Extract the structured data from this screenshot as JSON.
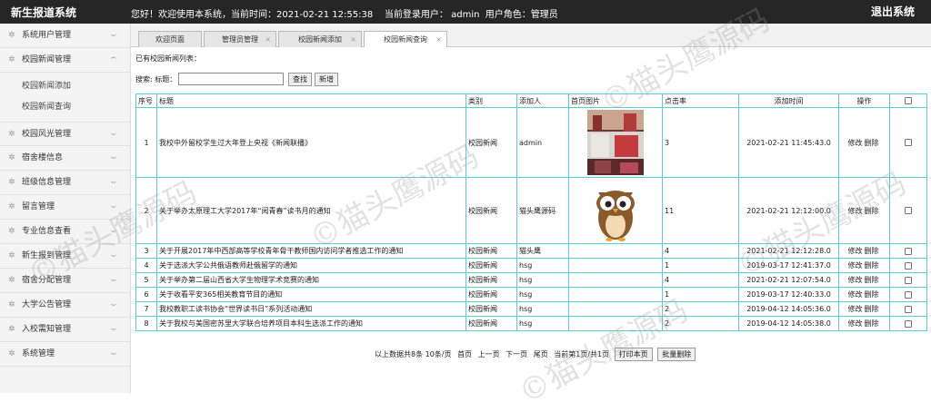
{
  "header": {
    "title": "新生报道系统",
    "welcome": "您好！欢迎使用本系统，当前时间：2021-02-21 12:55:38    当前登录用户： admin  用户角色：管理员",
    "logout": "退出系统"
  },
  "sidebar": {
    "menu_top": [
      {
        "label": "系统用户管理"
      },
      {
        "label": "校园新闻管理"
      }
    ],
    "sub_items": [
      {
        "label": "校园新闻添加"
      },
      {
        "label": "校园新闻查询"
      }
    ],
    "menu_bottom": [
      {
        "label": "校园风光管理"
      },
      {
        "label": "宿舍楼信息"
      },
      {
        "label": "班级信息管理"
      },
      {
        "label": "留言管理"
      },
      {
        "label": "专业信息查看"
      },
      {
        "label": "新生报到管理"
      },
      {
        "label": "宿舍分配管理"
      },
      {
        "label": "大学公告管理"
      },
      {
        "label": "入校需知管理"
      },
      {
        "label": "系统管理"
      }
    ],
    "collapse": "◀"
  },
  "tabs": [
    {
      "label": "欢迎页面"
    },
    {
      "label": "管理员管理"
    },
    {
      "label": "校园新闻添加"
    },
    {
      "label": "校园新闻查询"
    }
  ],
  "content": {
    "caption": "已有校园新闻列表：",
    "search_label": "搜索: 标题：",
    "search_value": "",
    "search_button": "查找",
    "add_button": "新增"
  },
  "table": {
    "headers": [
      "序号",
      "标题",
      "类别",
      "添加人",
      "首页图片",
      "点击率",
      "添加时间",
      "操作"
    ],
    "rows": [
      {
        "no": "1",
        "title": "我校中外留校学生过大年登上央视《新闻联播》",
        "category": "校园新闻",
        "adder": "admin",
        "clicks": "3",
        "time": "2021-02-21 11:45:43.0"
      },
      {
        "no": "2",
        "title": "关于举办太原理工大学2017年“阅青春”读书月的通知",
        "category": "校园新闻",
        "adder": "猫头鹰源码",
        "clicks": "11",
        "time": "2021-02-21 12:12:00.0"
      },
      {
        "no": "3",
        "title": "关于开展2017年中西部高等学校青年骨干教师国内访问学者推选工作的通知",
        "category": "校园新闻",
        "adder": "猫头鹰",
        "clicks": "4",
        "time": "2021-02-21 12:12:28.0"
      },
      {
        "no": "4",
        "title": "关于选派大学公共俄语教师赴俄留学的通知",
        "category": "校园新闻",
        "adder": "hsg",
        "clicks": "1",
        "time": "2019-03-17 12:41:37.0"
      },
      {
        "no": "5",
        "title": "关于举办第二届山西省大学生物理学术竞赛的通知",
        "category": "校园新闻",
        "adder": "hsg",
        "clicks": "4",
        "time": "2021-02-21 12:07:54.0"
      },
      {
        "no": "6",
        "title": "关于收看平安365相关教育节目的通知",
        "category": "校园新闻",
        "adder": "hsg",
        "clicks": "1",
        "time": "2019-03-17 12:40:33.0"
      },
      {
        "no": "7",
        "title": "我校教职工读书协会“世界读书日”系列活动通知",
        "category": "校园新闻",
        "adder": "hsg",
        "clicks": "2",
        "time": "2019-04-12 14:05:36.0"
      },
      {
        "no": "8",
        "title": "关于我校与美国密苏里大学联合培养项目本科生选派工作的通知",
        "category": "校园新闻",
        "adder": "hsg",
        "clicks": "2",
        "time": "2019-04-12 14:05:38.0"
      }
    ],
    "edit": "修改",
    "delete": "删除"
  },
  "pager": {
    "info": "以上数据共8条  10条/页",
    "first": "首页",
    "prev": "上一页",
    "next": "下一页",
    "last": "尾页",
    "current": "当前第1页/共1页",
    "print": "打印本页",
    "batch_delete": "批量删除"
  },
  "watermark": "©猫头鹰源码"
}
